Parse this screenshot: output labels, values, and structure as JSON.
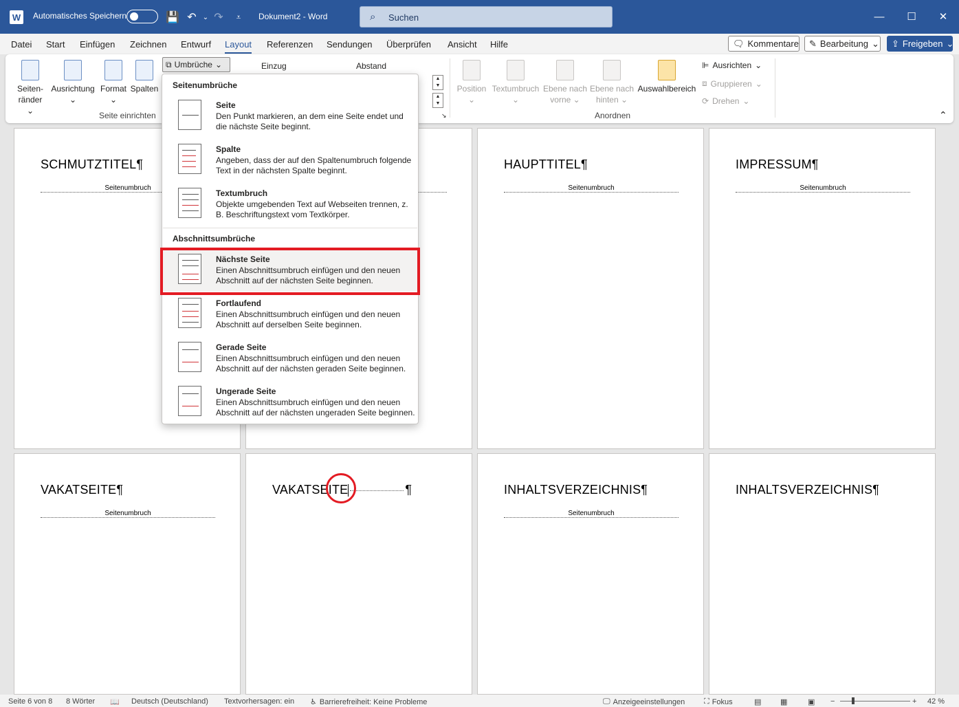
{
  "titlebar": {
    "autosave_label": "Automatisches Speichern",
    "doc_title": "Dokument2  -  Word",
    "search_placeholder": "Suchen"
  },
  "menu": {
    "items": [
      "Datei",
      "Start",
      "Einfügen",
      "Zeichnen",
      "Entwurf",
      "Layout",
      "Referenzen",
      "Sendungen",
      "Überprüfen",
      "Ansicht",
      "Hilfe"
    ],
    "active": "Layout",
    "comments": "Kommentare",
    "editing": "Bearbeitung",
    "share": "Freigeben"
  },
  "ribbon": {
    "page_setup": {
      "margins": [
        "Seiten-",
        "ränder"
      ],
      "orientation": "Ausrichtung",
      "size": "Format",
      "columns": "Spalten",
      "breaks": "Umbrüche",
      "group_label": "Seite einrichten"
    },
    "paragraph": {
      "indent": "Einzug",
      "spacing": "Abstand"
    },
    "arrange": {
      "position": "Position",
      "wrap": "Textumbruch",
      "forward": [
        "Ebene nach",
        "vorne"
      ],
      "backward": [
        "Ebene nach",
        "hinten"
      ],
      "selection_pane": "Auswahlbereich",
      "align": "Ausrichten",
      "group": "Gruppieren",
      "rotate": "Drehen",
      "group_label": "Anordnen"
    }
  },
  "dropdown": {
    "section_page": "Seitenumbrüche",
    "section_section": "Abschnittsumbrüche",
    "items": [
      {
        "title": "Seite",
        "desc": "Den Punkt markieren, an dem eine Seite endet und die nächste Seite beginnt."
      },
      {
        "title": "Spalte",
        "desc": "Angeben, dass der auf den Spaltenumbruch folgende Text in der nächsten Spalte beginnt."
      },
      {
        "title": "Textumbruch",
        "desc": "Objekte umgebenden Text auf Webseiten trennen, z. B. Beschriftungstext vom Textkörper."
      },
      {
        "title": "Nächste Seite",
        "desc": "Einen Abschnittsumbruch einfügen und den neuen Abschnitt auf der nächsten Seite beginnen."
      },
      {
        "title": "Fortlaufend",
        "desc": "Einen Abschnittsumbruch einfügen und den neuen Abschnitt auf derselben Seite beginnen."
      },
      {
        "title": "Gerade Seite",
        "desc": "Einen Abschnittsumbruch einfügen und den neuen Abschnitt auf der nächsten geraden Seite beginnen."
      },
      {
        "title": "Ungerade Seite",
        "desc": "Einen Abschnittsumbruch einfügen und den neuen Abschnitt auf der nächsten ungeraden Seite beginnen."
      }
    ]
  },
  "pages": {
    "break_label": "Seitenumbruch",
    "headings": [
      "SCHMUTZTITEL¶",
      "",
      "HAUPTTITEL¶",
      "IMPRESSUM¶",
      "VAKATSEITE¶",
      "VAKATSEITE",
      "INHALTSVERZEICHNIS¶",
      "INHALTSVERZEICHNIS¶"
    ],
    "pilcrow": "¶"
  },
  "status": {
    "page": "Seite 6 von 8",
    "words": "8 Wörter",
    "language": "Deutsch (Deutschland)",
    "predictions": "Textvorhersagen: ein",
    "accessibility": "Barrierefreiheit: Keine Probleme",
    "display_settings": "Anzeigeeinstellungen",
    "focus": "Fokus",
    "zoom": "42 %"
  },
  "colors": {
    "word_blue": "#2b579a",
    "highlight_red": "#e31b23"
  }
}
